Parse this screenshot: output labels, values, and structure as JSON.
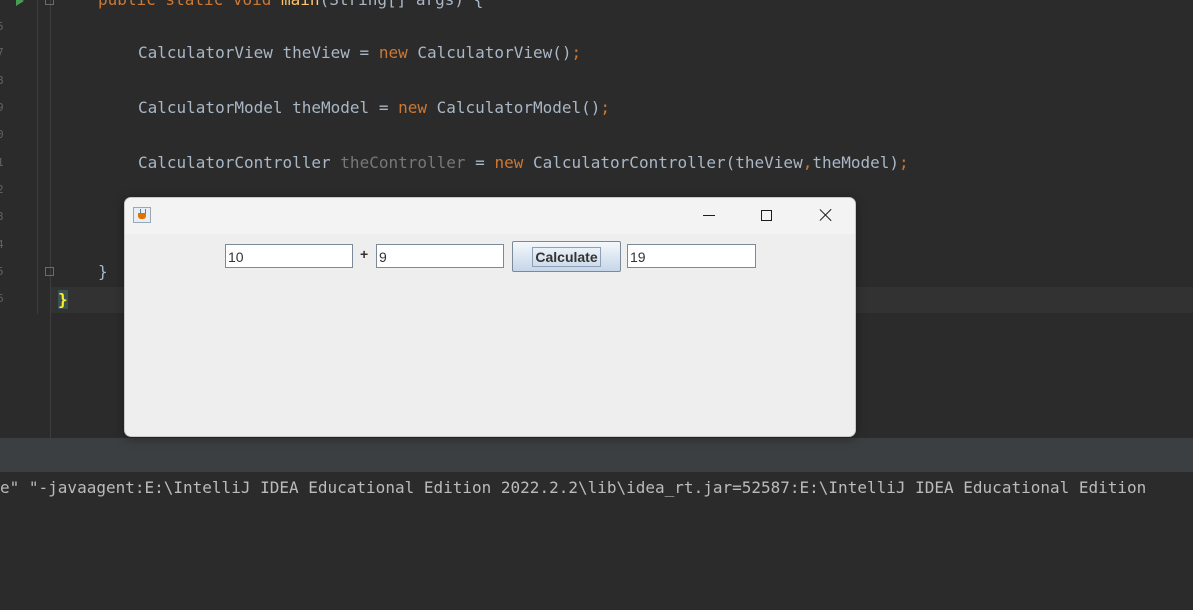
{
  "editor": {
    "line_numbers": [
      "5",
      "7",
      "8",
      "9",
      "0",
      "1",
      "2",
      "3",
      "4",
      "5",
      "6"
    ],
    "lines": {
      "l1": {
        "kw1": "public static void ",
        "fn": "main",
        "rest": "(String[] args) {"
      },
      "l2": {
        "a": "CalculatorView theView = ",
        "kw": "new",
        "b": " CalculatorView()",
        "semi": ";"
      },
      "l3": {
        "a": "CalculatorModel theModel = ",
        "kw": "new",
        "b": " CalculatorModel()",
        "semi": ";"
      },
      "l4": {
        "a": "CalculatorController ",
        "dim": "theController",
        "b": " = ",
        "kw": "new",
        "c": " CalculatorController(theView",
        "comma": ",",
        "d": "theModel)",
        "semi": ";"
      },
      "l5": "}",
      "l6": "}"
    }
  },
  "console": {
    "line": "e\" \"-javaagent:E:\\IntelliJ IDEA Educational Edition 2022.2.2\\lib\\idea_rt.jar=52587:E:\\IntelliJ IDEA Educational Edition"
  },
  "window": {
    "field1_value": "10",
    "operator": "+",
    "field2_value": "9",
    "calculate_label": "Calculate",
    "result_value": "19"
  },
  "icons": {
    "app_icon": "java-icon",
    "minimize": "minimize-icon",
    "maximize": "maximize-icon",
    "close": "close-icon",
    "run": "run-icon"
  },
  "colors": {
    "editor_bg": "#2b2b2b",
    "keyword": "#cc7832",
    "method": "#ffc66d",
    "text": "#a9b7c6",
    "window_bg": "#eeeeee"
  }
}
